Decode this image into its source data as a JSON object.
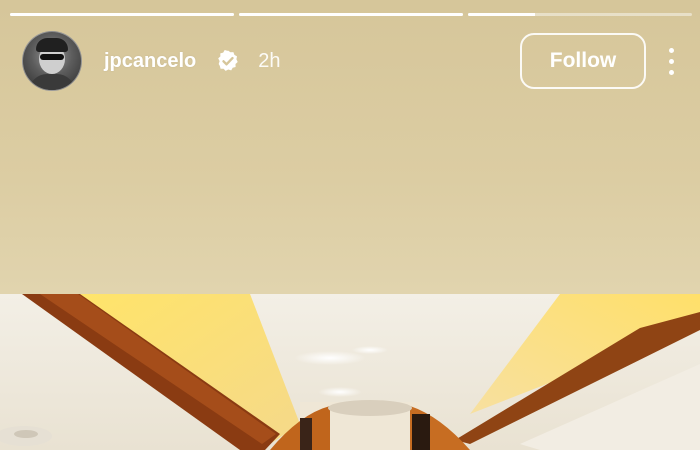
{
  "story": {
    "progress": [
      {
        "segment": 1,
        "fill": 1.0
      },
      {
        "segment": 2,
        "fill": 1.0
      },
      {
        "segment": 3,
        "fill": 0.3
      }
    ],
    "header": {
      "username": "jpcancelo",
      "verified": true,
      "time_ago": "2h",
      "follow_label": "Follow",
      "more_icon": "more-vertical-icon",
      "verified_icon": "verified-badge-icon"
    },
    "background_color": "#dccda3"
  }
}
